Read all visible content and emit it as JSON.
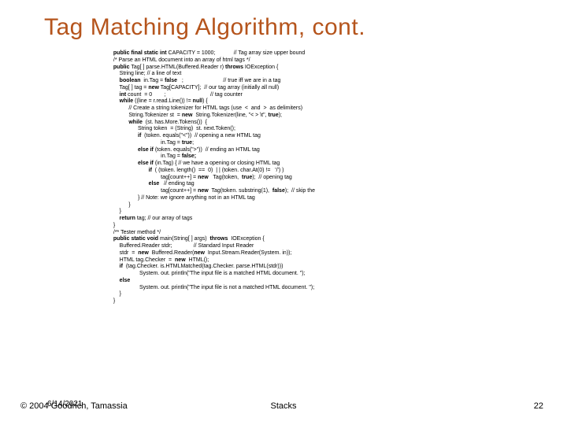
{
  "title": "Tag Matching Algorithm, cont.",
  "code": "  <b>public final static int</b> CAPACITY = 1000;            // Tag array size upper bound\n  /* Parse an HTML document into an array of html tags */\n  <b>public</b> Tag[ ] parse.HTML(Buffered.Reader r) <b>throws</b> IOException {\n      String line; // a line of text\n      <b>boolean</b>  in.Tag = <b>false</b>   ;                          // true iff we are in a tag\n      Tag[ ] tag = <b>new</b> Tag[CAPACITY];  // our tag array (initially all null)\n      <b>int</b> count  = 0        ;                             // tag counter\n      <b>while</b> ((line = r.read.Line()) != <b>null</b>) {\n            // Create a string tokenizer for HTML tags (use  &lt;  and  &gt;  as delimiters)\n            String.Tokenizer st  = <b>new</b>  String.Tokenizer(line, \"&lt; &gt; \\t\", <b>true</b>);\n            <b>while</b>  (st. has.More.Tokens())  {\n                  String token  = (String)  st. next.Token();\n                  <b>if</b>  (token. equals(\"&lt;\"))  // opening a new HTML tag\n                                 in.Tag = <b>true</b>;\n                  <b>else if</b> (token. equals(\"&gt;\"))  // ending an HTML tag\n                                 in.Tag = <b>false;</b>\n                  <b>else if</b> (in.Tag) { // we have a opening or closing HTML tag\n                         <b>if</b>  ( (token. length()  ==  0)  | | (token. char.At(0) !=   '/') )\n                                 tag[count++] = <b>new</b>   Tag(token,  <b>true</b>);  // opening tag\n                         <b>else</b>   // ending tag\n                                 tag[count++] = <b>new</b>  Tag(token. substring(1),  <b>false</b>);  // skip the\n                  } // Note: we ignore anything not in an HTML tag\n            }\n      }\n      <b>return</b> tag; // our array of tags\n  }\n  /** Tester method */\n  <b>public static void</b> main(String[ ] args)  <b>throws</b>  IOException {\n      Buffered.Reader stdr;              // Standard Input Reader\n      stdr  =  <b>new</b>  Buffered.Reader(<b>new</b>  Input.Stream.Reader(System. in));\n      HTML tag.Checker  =  <b>new</b>  HTML();\n      <b>if</b>  (tag.Checker. is.HTMLMatched(tag.Checker. parse.HTML(stdr)))\n                   System. out. println(\"The input file is a matched HTML document. \");\n      <b>else</b>\n                   System. out. println(\"The input file is not a matched HTML document. \");\n      }\n  }",
  "footer": {
    "left": "© 2004 Goodrich, Tamassia",
    "date_overlay": "6/14/2021",
    "center": "Stacks",
    "right": "22"
  }
}
